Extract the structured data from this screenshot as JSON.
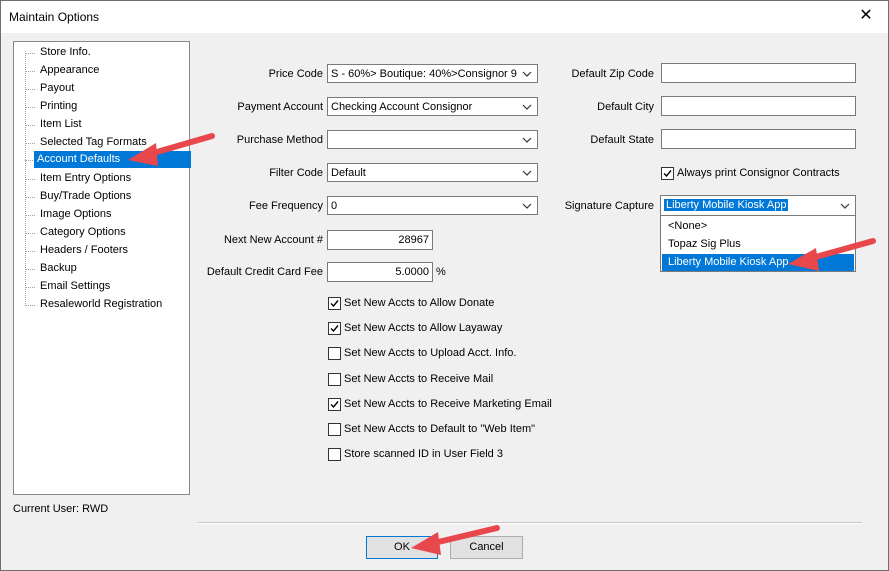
{
  "window": {
    "title": "Maintain Options"
  },
  "tree": {
    "items": [
      {
        "label": "Store Info."
      },
      {
        "label": "Appearance"
      },
      {
        "label": "Payout"
      },
      {
        "label": "Printing"
      },
      {
        "label": "Item List"
      },
      {
        "label": "Selected Tag Formats"
      },
      {
        "label": "Account Defaults",
        "selected": true
      },
      {
        "label": "Item Entry Options"
      },
      {
        "label": "Buy/Trade Options"
      },
      {
        "label": "Image Options"
      },
      {
        "label": "Category Options"
      },
      {
        "label": "Headers / Footers"
      },
      {
        "label": "Backup"
      },
      {
        "label": "Email Settings"
      },
      {
        "label": "Resaleworld Registration"
      }
    ]
  },
  "form": {
    "price_code": {
      "label": "Price Code",
      "value": "S - 60%> Boutique: 40%>Consignor 9"
    },
    "payment_account": {
      "label": "Payment Account",
      "value": "Checking Account Consignor"
    },
    "purchase_method": {
      "label": "Purchase Method",
      "value": ""
    },
    "filter_code": {
      "label": "Filter Code",
      "value": "Default"
    },
    "fee_frequency": {
      "label": "Fee Frequency",
      "value": "0"
    },
    "next_new_account": {
      "label": "Next New Account #",
      "value": "28967"
    },
    "default_cc_fee": {
      "label": "Default Credit Card Fee",
      "value": "5.0000",
      "unit": "%"
    },
    "default_zip": {
      "label": "Default Zip Code",
      "value": ""
    },
    "default_city": {
      "label": "Default City",
      "value": ""
    },
    "default_state": {
      "label": "Default State",
      "value": ""
    },
    "always_print": {
      "label": "Always print Consignor Contracts",
      "checked": true
    },
    "signature_capture": {
      "label": "Signature Capture",
      "value": "Liberty Mobile Kiosk App",
      "options": [
        "<None>",
        "Topaz Sig Plus",
        "Liberty Mobile Kiosk App"
      ]
    }
  },
  "checkboxes": [
    {
      "label": "Set New Accts to Allow Donate",
      "checked": true
    },
    {
      "label": "Set New Accts to Allow Layaway",
      "checked": true
    },
    {
      "label": "Set New Accts to Upload Acct. Info.",
      "checked": false
    },
    {
      "label": "Set New Accts to Receive Mail",
      "checked": false
    },
    {
      "label": "Set New Accts to Receive Marketing Email",
      "checked": true
    },
    {
      "label": "Set New Accts to Default to \"Web Item\"",
      "checked": false
    },
    {
      "label": "Store scanned ID in User Field 3",
      "checked": false
    }
  ],
  "status": {
    "current_user": "Current User: RWD"
  },
  "buttons": {
    "ok": "OK",
    "cancel": "Cancel"
  },
  "colors": {
    "selection": "#0078d7",
    "annotation_arrow": "#e8474b"
  },
  "icons": {
    "close": "close-icon",
    "dropdown": "chevron-down-icon",
    "check": "check-icon",
    "annotation": "red-arrow-icon"
  }
}
